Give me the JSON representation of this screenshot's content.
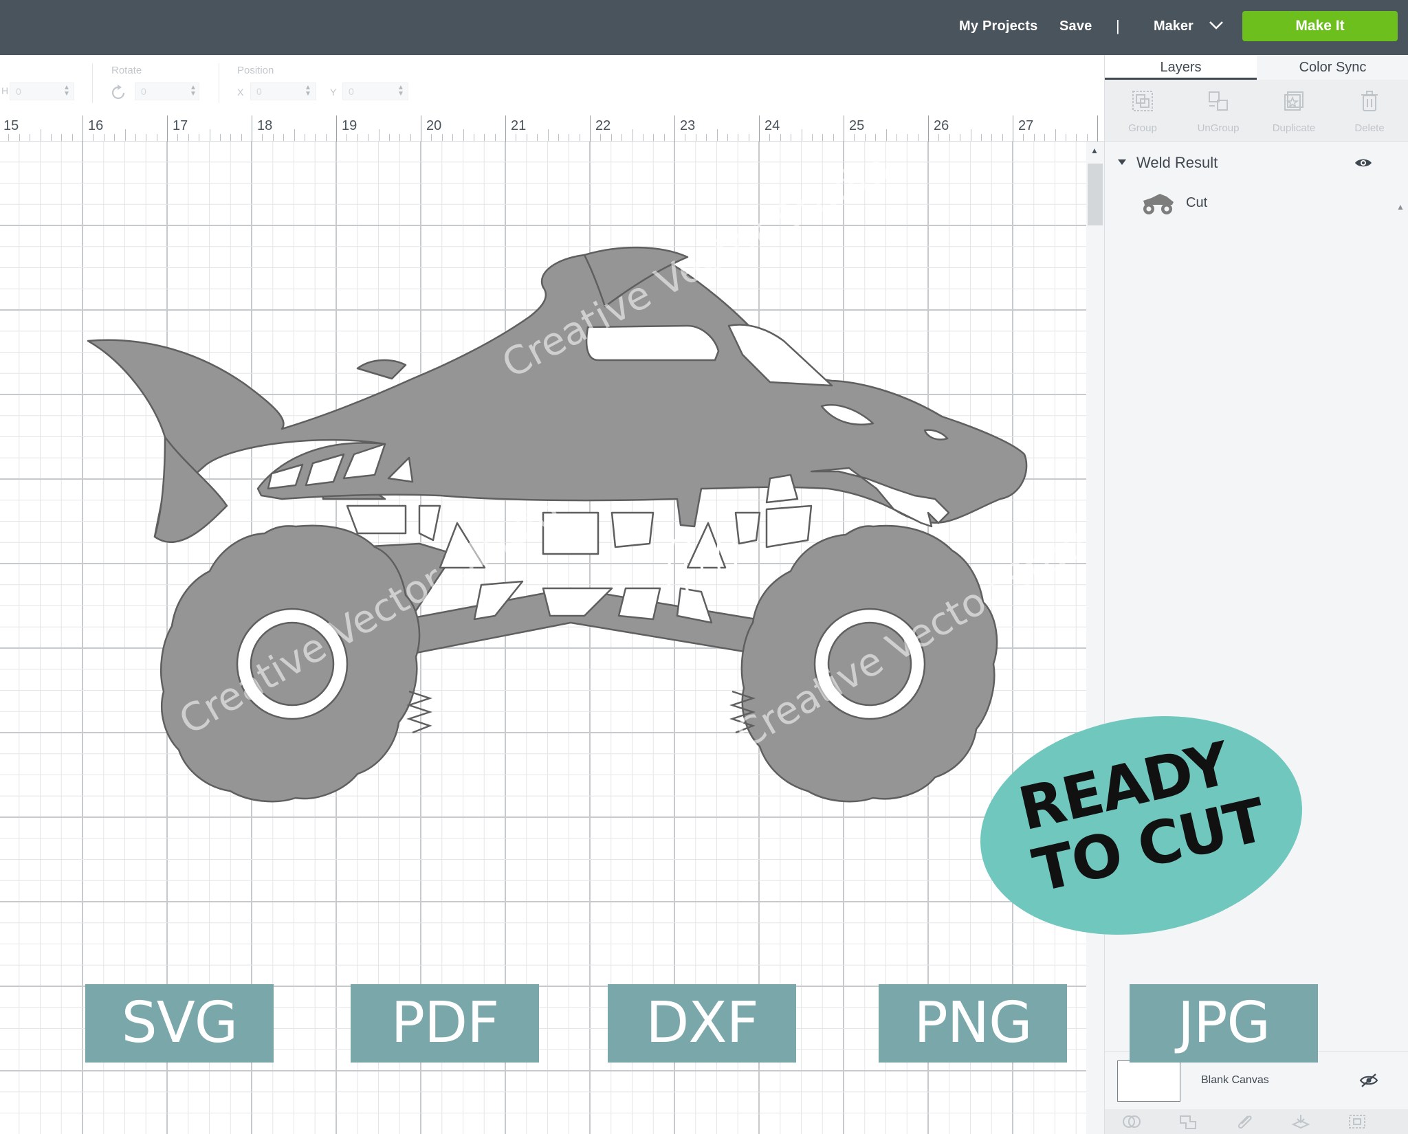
{
  "topbar": {
    "my_projects": "My Projects",
    "save": "Save",
    "separator": "|",
    "machine": "Maker",
    "make_it": "Make It"
  },
  "edit_toolbar": {
    "size_short_label": "H",
    "size_value": "0",
    "rotate_label": "Rotate",
    "rotate_value": "0",
    "position_label": "Position",
    "x_label": "X",
    "x_value": "0",
    "y_label": "Y",
    "y_value": "0"
  },
  "ruler": {
    "numbers": [
      "15",
      "16",
      "17",
      "18",
      "19",
      "20",
      "21",
      "22",
      "23",
      "24",
      "25",
      "26",
      "27"
    ]
  },
  "panel": {
    "tabs": [
      {
        "label": "Layers",
        "active": true
      },
      {
        "label": "Color Sync",
        "active": false
      }
    ],
    "actions": [
      {
        "label": "Group",
        "icon": "group-icon"
      },
      {
        "label": "UnGroup",
        "icon": "ungroup-icon"
      },
      {
        "label": "Duplicate",
        "icon": "duplicate-icon"
      },
      {
        "label": "Delete",
        "icon": "delete-icon"
      }
    ],
    "layer_group": "Weld Result",
    "layer_item": "Cut",
    "blank_canvas": "Blank Canvas"
  },
  "formats": [
    "SVG",
    "PDF",
    "DXF",
    "PNG",
    "JPG"
  ],
  "ready_badge": {
    "line1": "READY",
    "line2": "TO CUT"
  },
  "watermark_text": "Creative Vector Studio",
  "colors": {
    "topbar": "#4a545d",
    "make_it": "#6cbf1d",
    "design_fill": "#959595",
    "badge": "#7aa7a9",
    "ready": "#6fc7bd"
  }
}
